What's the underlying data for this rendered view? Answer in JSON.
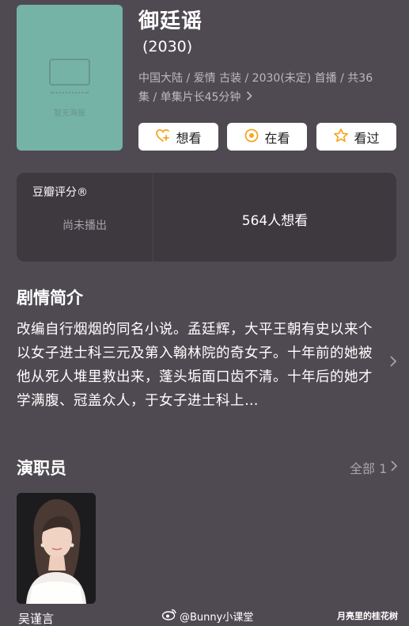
{
  "show": {
    "title": "御廷谣",
    "year": "(2030)",
    "meta_line1": "中国大陆 / 爱情 古装 / 2030(未定) 首播 / 共36",
    "meta_line2": "集 / 单集片长45分钟",
    "poster_watermark": "暂无海报"
  },
  "actions": {
    "want_label": "想看",
    "watching_label": "在看",
    "watched_label": "看过",
    "accent_color": "#f5a623"
  },
  "rating": {
    "label": "豆瓣评分®",
    "status": "尚未播出",
    "wants": "564人想看"
  },
  "synopsis": {
    "title": "剧情简介",
    "text": "改编自行烟烟的同名小说。孟廷辉，大平王朝有史以来个以女子进士科三元及第入翰林院的奇女子。十年前的她被他从死人堆里救出来，蓬头垢面口齿不清。十年后的她才学满腹、冠盖众人，于女子进士科上…"
  },
  "cast": {
    "title": "演职员",
    "all_label": "全部 1",
    "members": [
      {
        "name": "吴谨言"
      }
    ]
  },
  "footer": {
    "weibo_handle": "@Bunny小课堂",
    "site_mark": "月亮里的桂花树"
  },
  "icons": [
    "heart-plus-icon",
    "circle-dot-icon",
    "star-icon",
    "chevron-right-icon",
    "weibo-icon"
  ]
}
